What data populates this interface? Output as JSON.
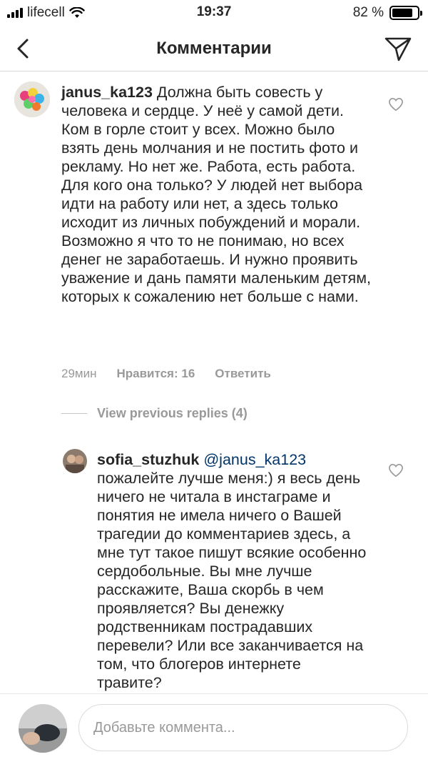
{
  "status_bar": {
    "carrier": "lifecell",
    "time": "19:37",
    "battery_percent": "82 %",
    "battery_level": 0.82
  },
  "nav": {
    "title": "Комментарии"
  },
  "comments": [
    {
      "username": "janus_ka123",
      "text": "Должна быть совесть у человека и сердце. У неё у самой дети. Ком в горле стоит у всех. Можно было взять день молчания и не постить фото и рекламу. Но нет же. Работа, есть работа. Для кого она только? У людей нет выбора идти на работу или нет, а здесь только исходит из личных побуждений и морали. Возможно я что то не понимаю, но всех денег не заработаешь. И нужно проявить уважение и дань памяти маленьким детям, которых к сожалению нет больше с нами.",
      "time": "29мин",
      "likes": "Нравится: 16",
      "reply": "Ответить"
    }
  ],
  "replies_toggle": "View previous replies (4)",
  "reply": {
    "username": "sofia_stuzhuk",
    "mention": "@janus_ka123",
    "text": "пожалейте лучше меня:) я весь день ничего не читала в инстаграме и понятия не имела ничего о Вашей трагедии до комментариев здесь, а мне тут такое пишут всякие особенно сердобольные. Вы мне лучше расскажите, Ваша скорбь в чем проявляется? Вы денежку родственникам пострадавших перевели? Или все заканчивается на том, что блогеров интернете травите?"
  },
  "input": {
    "placeholder": "Добавьте коммента..."
  },
  "icons": {
    "back": "chevron-left-icon",
    "send": "paper-plane-icon",
    "like": "heart-outline-icon",
    "wifi": "wifi-icon",
    "signal": "cellular-signal-icon",
    "battery": "battery-icon"
  }
}
